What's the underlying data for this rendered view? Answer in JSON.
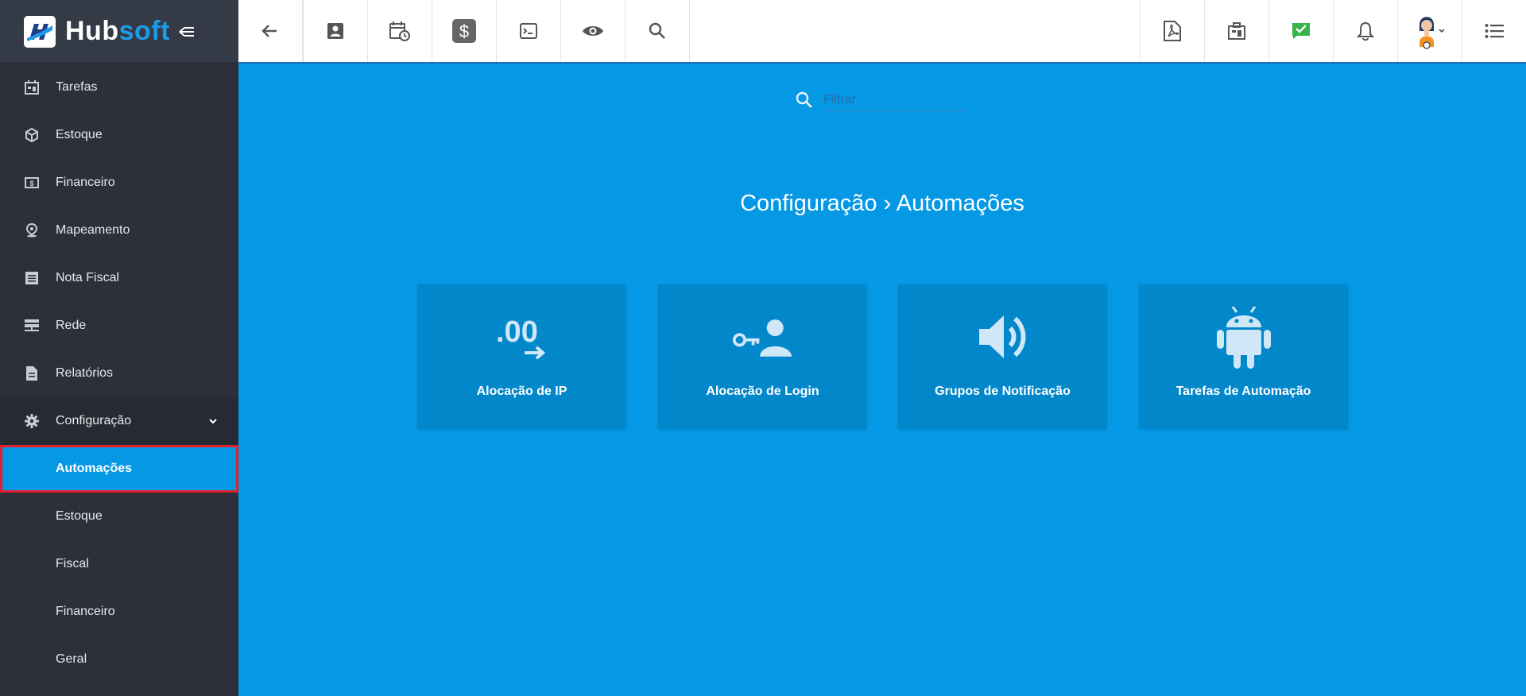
{
  "app": {
    "logo_hub": "Hub",
    "logo_soft": "soft"
  },
  "sidebar": {
    "items": [
      {
        "label": "Tarefas",
        "icon": "tasks-calendar-icon"
      },
      {
        "label": "Estoque",
        "icon": "box-icon"
      },
      {
        "label": "Financeiro",
        "icon": "money-icon"
      },
      {
        "label": "Mapeamento",
        "icon": "map-pin-icon"
      },
      {
        "label": "Nota Fiscal",
        "icon": "document-list-icon"
      },
      {
        "label": "Rede",
        "icon": "server-icon"
      },
      {
        "label": "Relatórios",
        "icon": "report-file-icon"
      },
      {
        "label": "Configuração",
        "icon": "gear-icon"
      }
    ],
    "subitems": [
      {
        "label": "Automações"
      },
      {
        "label": "Estoque"
      },
      {
        "label": "Fiscal"
      },
      {
        "label": "Financeiro"
      },
      {
        "label": "Geral"
      }
    ]
  },
  "search": {
    "placeholder": "Filtrar"
  },
  "main": {
    "title": "Configuração › Automações",
    "cards": [
      {
        "label": "Alocação de IP",
        "icon": "ip-allocation-icon"
      },
      {
        "label": "Alocação de Login",
        "icon": "key-user-icon"
      },
      {
        "label": "Grupos de Notificação",
        "icon": "speaker-icon"
      },
      {
        "label": "Tarefas de Automação",
        "icon": "android-icon"
      }
    ]
  },
  "colors": {
    "accent": "#0498e5",
    "sidebar": "#2b303a",
    "card": "#0287cb",
    "highlight": "#e0202a"
  }
}
